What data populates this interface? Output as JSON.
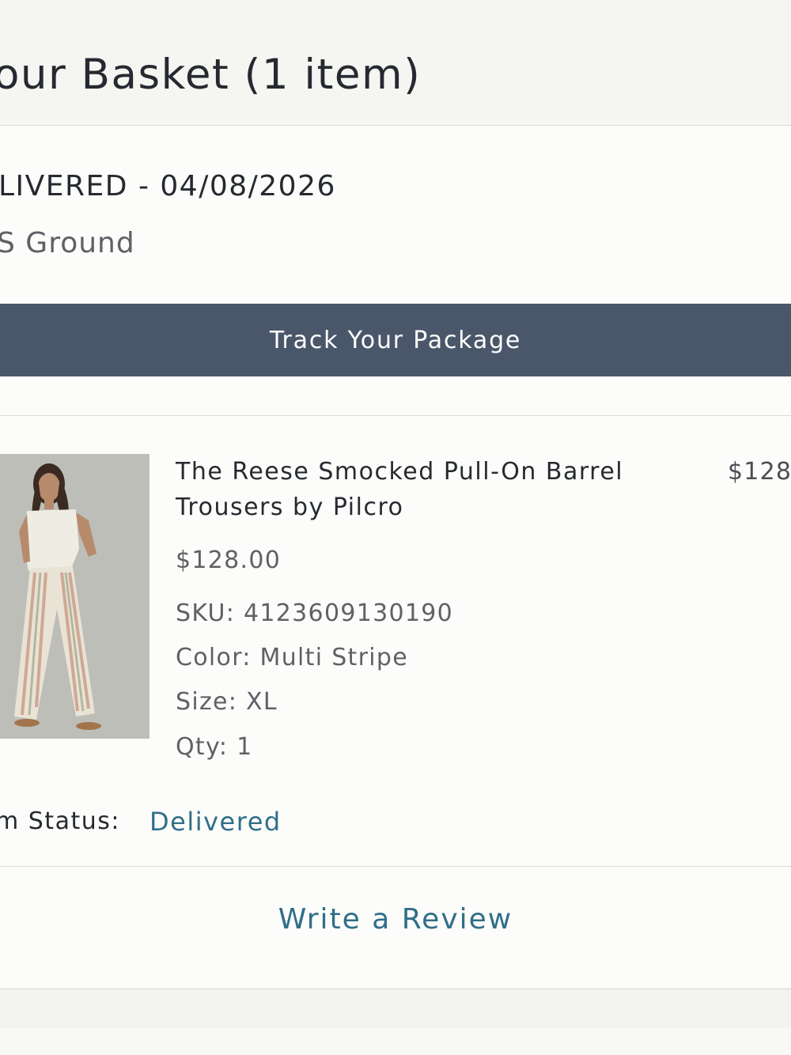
{
  "header": {
    "title": "our Basket (1 item)"
  },
  "shipment": {
    "status_line": "LIVERED - 04/08/2026",
    "method": "S Ground",
    "track_button_label": "Track Your Package"
  },
  "item": {
    "title": "The Reese Smocked Pull-On Barrel Trousers by Pilcro",
    "line_price": "$128",
    "price": "$128.00",
    "sku": "SKU: 4123609130190",
    "color": "Color: Multi Stripe",
    "size": "Size: XL",
    "qty": "Qty: 1",
    "status_label": "m Status:",
    "status_value": "Delivered",
    "image_icon": "product-photo"
  },
  "actions": {
    "review_label": "Write a Review"
  },
  "colors": {
    "button_bg": "#4a5669",
    "link": "#2f6f88",
    "text": "#262a30"
  }
}
